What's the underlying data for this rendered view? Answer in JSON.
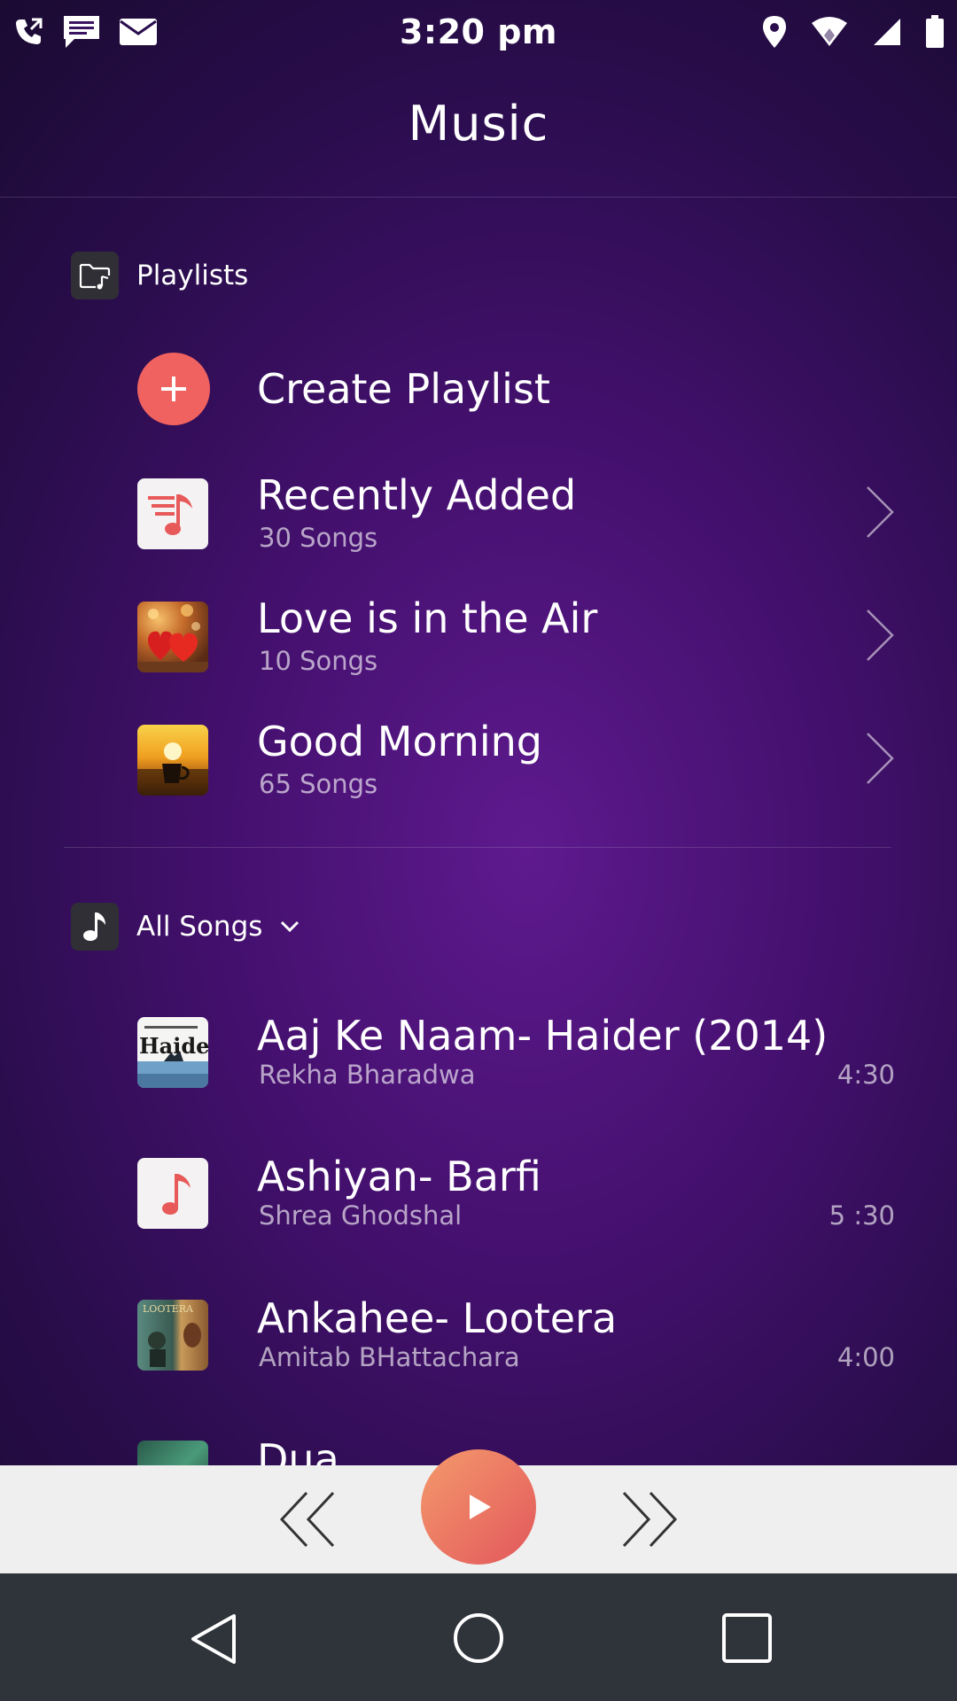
{
  "status": {
    "time": "3:20 pm",
    "icons_left": [
      "phone-icon",
      "message-icon",
      "mail-icon"
    ],
    "icons_right": [
      "location-icon",
      "wifi-icon",
      "signal-icon",
      "battery-icon"
    ]
  },
  "header": {
    "title": "Music"
  },
  "playlists": {
    "label": "Playlists",
    "create_label": "Create Playlist",
    "items": [
      {
        "title": "Recently Added",
        "count": "30 Songs",
        "thumb": "music-note-icon"
      },
      {
        "title": "Love is in the Air",
        "count": "10 Songs",
        "thumb": "hearts-image"
      },
      {
        "title": "Good Morning",
        "count": "65 Songs",
        "thumb": "sunrise-cup-image"
      }
    ]
  },
  "songs": {
    "label": "All Songs",
    "items": [
      {
        "title": "Aaj Ke Naam- Haider (2014)",
        "artist": "Rekha Bharadwa",
        "duration": "4:30",
        "art_text": "Haider"
      },
      {
        "title": "Ashiyan- Barfi",
        "artist": "Shrea Ghodshal",
        "duration": "5 :30"
      },
      {
        "title": "Ankahee- Lootera",
        "artist": "Amitab BHattachara",
        "duration": "4:00",
        "art_text": "LOOTERA"
      },
      {
        "title": "Dua",
        "artist": "",
        "duration": ""
      }
    ]
  },
  "colors": {
    "accent": "#f0625f",
    "player_bg": "#efefef",
    "navbar_bg": "#2f333a"
  }
}
